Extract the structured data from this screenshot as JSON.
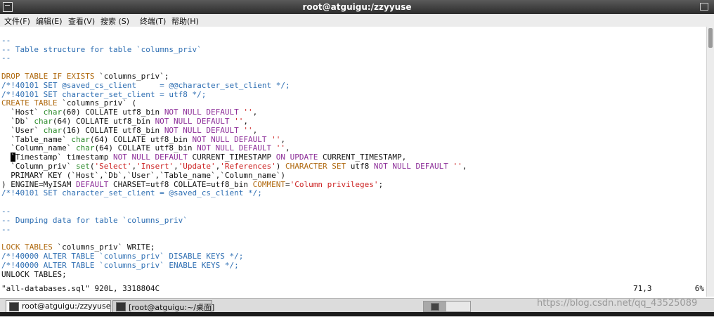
{
  "window": {
    "title": "root@atguigu:/zzyyuse"
  },
  "menu": [
    "文件(F)",
    "编辑(E)",
    "查看(V)",
    "搜索 (S)",
    "终端(T)",
    "帮助(H)"
  ],
  "lines": [
    [],
    [
      [
        "--",
        "blue"
      ]
    ],
    [
      [
        "-- Table structure for table `columns_priv`",
        "blue"
      ]
    ],
    [
      [
        "--",
        "blue"
      ]
    ],
    [],
    [
      [
        "DROP TABLE IF EXISTS",
        "kw"
      ],
      [
        " `columns_priv`;",
        ""
      ]
    ],
    [
      [
        "/*!40101 SET @saved_cs_client     = @@character_set_client */;",
        "blue"
      ]
    ],
    [
      [
        "/*!40101 SET character_set_client = utf8 */;",
        "blue"
      ]
    ],
    [
      [
        "CREATE TABLE",
        "kw"
      ],
      [
        " `columns_priv` (",
        ""
      ]
    ],
    [
      [
        "  `Host` ",
        ""
      ],
      [
        "char",
        "green"
      ],
      [
        "(60) COLLATE utf8_bin ",
        ""
      ],
      [
        "NOT NULL DEFAULT",
        "pur"
      ],
      [
        " ",
        ""
      ],
      [
        "''",
        "str"
      ],
      [
        ",",
        ""
      ]
    ],
    [
      [
        "  `Db` ",
        ""
      ],
      [
        "char",
        "green"
      ],
      [
        "(64) COLLATE utf8_bin ",
        ""
      ],
      [
        "NOT NULL DEFAULT",
        "pur"
      ],
      [
        " ",
        ""
      ],
      [
        "''",
        "str"
      ],
      [
        ",",
        ""
      ]
    ],
    [
      [
        "  `User` ",
        ""
      ],
      [
        "char",
        "green"
      ],
      [
        "(16) COLLATE utf8_bin ",
        ""
      ],
      [
        "NOT NULL DEFAULT",
        "pur"
      ],
      [
        " ",
        ""
      ],
      [
        "''",
        "str"
      ],
      [
        ",",
        ""
      ]
    ],
    [
      [
        "  `Table_name` ",
        ""
      ],
      [
        "char",
        "green"
      ],
      [
        "(64) COLLATE utf8_bin ",
        ""
      ],
      [
        "NOT NULL DEFAULT",
        "pur"
      ],
      [
        " ",
        ""
      ],
      [
        "''",
        "str"
      ],
      [
        ",",
        ""
      ]
    ],
    [
      [
        "  `Column_name` ",
        ""
      ],
      [
        "char",
        "green"
      ],
      [
        "(64) COLLATE utf8_bin ",
        ""
      ],
      [
        "NOT NULL DEFAULT",
        "pur"
      ],
      [
        " ",
        ""
      ],
      [
        "''",
        "str"
      ],
      [
        ",",
        ""
      ]
    ],
    [
      [
        "  ",
        ""
      ],
      [
        "`",
        "cursor"
      ],
      [
        "Timestamp` timestamp ",
        ""
      ],
      [
        "NOT NULL DEFAULT",
        "pur"
      ],
      [
        " CURRENT_TIMESTAMP ",
        ""
      ],
      [
        "ON UPDATE",
        "pur"
      ],
      [
        " CURRENT_TIMESTAMP,",
        ""
      ]
    ],
    [
      [
        "  `Column_priv` ",
        ""
      ],
      [
        "set",
        "green"
      ],
      [
        "(",
        ""
      ],
      [
        "'Select'",
        "str"
      ],
      [
        ",",
        ""
      ],
      [
        "'Insert'",
        "str"
      ],
      [
        ",",
        ""
      ],
      [
        "'Update'",
        "str"
      ],
      [
        ",",
        ""
      ],
      [
        "'References'",
        "str"
      ],
      [
        ") ",
        ""
      ],
      [
        "CHARACTER SET",
        "kw"
      ],
      [
        " utf8 ",
        ""
      ],
      [
        "NOT NULL DEFAULT",
        "pur"
      ],
      [
        " ",
        ""
      ],
      [
        "''",
        "str"
      ],
      [
        ",",
        ""
      ]
    ],
    [
      [
        "  PRIMARY KEY (`Host`,`Db`,`User`,`Table_name`,`Column_name`)",
        ""
      ]
    ],
    [
      [
        ") ENGINE=MyISAM ",
        ""
      ],
      [
        "DEFAULT",
        "pur"
      ],
      [
        " CHARSET=utf8 COLLATE=utf8_bin ",
        ""
      ],
      [
        "COMMENT",
        "kw"
      ],
      [
        "=",
        ""
      ],
      [
        "'Column privileges'",
        "str"
      ],
      [
        ";",
        ""
      ]
    ],
    [
      [
        "/*!40101 SET character_set_client = @saved_cs_client */;",
        "blue"
      ]
    ],
    [],
    [
      [
        "--",
        "blue"
      ]
    ],
    [
      [
        "-- Dumping data for table `columns_priv`",
        "blue"
      ]
    ],
    [
      [
        "--",
        "blue"
      ]
    ],
    [],
    [
      [
        "LOCK TABLES",
        "kw"
      ],
      [
        " `columns_priv` WRITE;",
        ""
      ]
    ],
    [
      [
        "/*!40000 ALTER TABLE `columns_priv` DISABLE KEYS */;",
        "blue"
      ]
    ],
    [
      [
        "/*!40000 ALTER TABLE `columns_priv` ENABLE KEYS */;",
        "blue"
      ]
    ],
    [
      [
        "UNLOCK TABLES;",
        ""
      ]
    ]
  ],
  "status": {
    "file": "\"all-databases.sql\" 920L, 3318804C",
    "position": "71,3",
    "percent": "6%"
  },
  "taskbar": {
    "item1": "root@atguigu:/zzyyuse",
    "item2": "[root@atguigu:~/桌面]"
  },
  "watermark": "https://blog.csdn.net/qq_43525089",
  "colors": {
    "comment": "#2f6fb3",
    "keyword": "#b06a10",
    "constraint": "#8d2f99",
    "string": "#cc2222",
    "type": "#2a8a2a"
  }
}
